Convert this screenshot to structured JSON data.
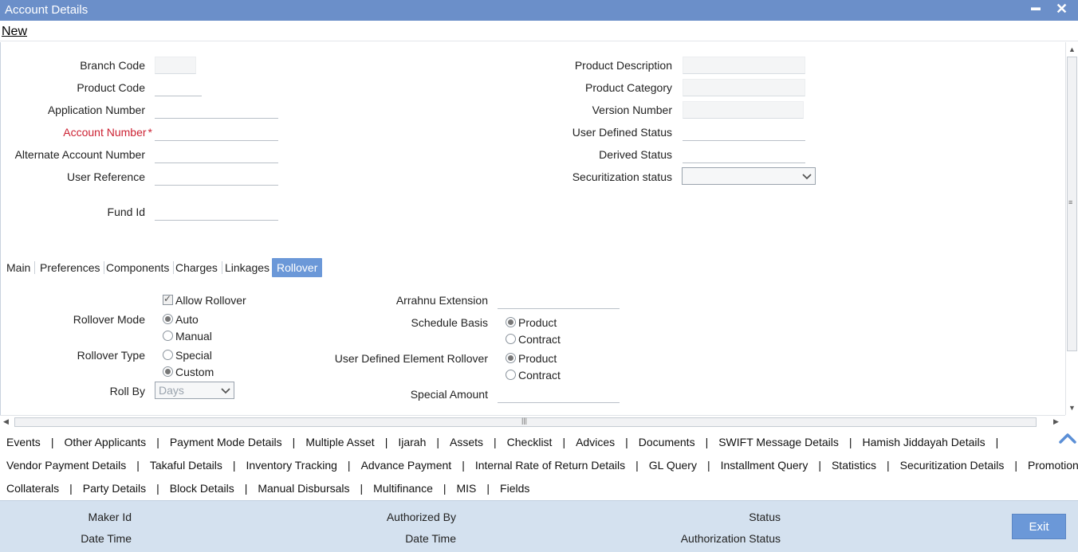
{
  "window": {
    "title": "Account Details",
    "minimize_glyph": "▬",
    "close_glyph": "✕"
  },
  "menu": {
    "new_label": "New"
  },
  "header_fields": {
    "branch_code": {
      "label": "Branch Code",
      "value": ""
    },
    "product_code": {
      "label": "Product Code",
      "value": ""
    },
    "application_number": {
      "label": "Application Number",
      "value": ""
    },
    "account_number": {
      "label": "Account Number",
      "value": "",
      "required_mark": "*"
    },
    "alternate_account_number": {
      "label": "Alternate Account Number",
      "value": ""
    },
    "user_reference": {
      "label": "User Reference",
      "value": ""
    },
    "fund_id": {
      "label": "Fund Id",
      "value": ""
    },
    "product_description": {
      "label": "Product Description",
      "value": ""
    },
    "product_category": {
      "label": "Product Category",
      "value": ""
    },
    "version_number": {
      "label": "Version Number",
      "value": ""
    },
    "user_defined_status": {
      "label": "User Defined Status",
      "value": ""
    },
    "derived_status": {
      "label": "Derived Status",
      "value": ""
    },
    "securitization_status": {
      "label": "Securitization status",
      "value": ""
    }
  },
  "tabs": [
    "Main",
    "Preferences",
    "Components",
    "Charges",
    "Linkages",
    "Rollover"
  ],
  "active_tab": "Rollover",
  "rollover": {
    "allow_rollover": {
      "label": "Allow Rollover",
      "checked": true
    },
    "rollover_mode": {
      "label": "Rollover Mode",
      "options": [
        "Auto",
        "Manual"
      ],
      "selected": "Auto"
    },
    "rollover_type": {
      "label": "Rollover Type",
      "options": [
        "Special",
        "Custom"
      ],
      "selected": "Custom"
    },
    "roll_by": {
      "label": "Roll By",
      "value": "Days"
    },
    "arrahnu_extension": {
      "label": "Arrahnu Extension",
      "value": ""
    },
    "schedule_basis": {
      "label": "Schedule Basis",
      "options": [
        "Product",
        "Contract"
      ],
      "selected": "Product"
    },
    "user_defined_element_rollover": {
      "label": "User Defined Element Rollover",
      "options": [
        "Product",
        "Contract"
      ],
      "selected": "Product"
    },
    "special_amount": {
      "label": "Special Amount",
      "value": ""
    }
  },
  "sub_links": {
    "row1": [
      "Events",
      "Other Applicants",
      "Payment Mode Details",
      "Multiple Asset",
      "Ijarah",
      "Assets",
      "Checklist",
      "Advices",
      "Documents",
      "SWIFT Message Details",
      "Hamish Jiddayah Details"
    ],
    "row2": [
      "Vendor Payment Details",
      "Takaful Details",
      "Inventory Tracking",
      "Advance Payment",
      "Internal Rate of Return Details",
      "GL Query",
      "Installment Query",
      "Statistics",
      "Securitization Details",
      "Promotions"
    ],
    "row3": [
      "Collaterals",
      "Party Details",
      "Block Details",
      "Manual Disbursals",
      "Multifinance",
      "MIS",
      "Fields"
    ],
    "separator": "|"
  },
  "footer": {
    "maker_id": "Maker Id",
    "maker_date_time": "Date Time",
    "authorized_by": "Authorized By",
    "auth_date_time": "Date Time",
    "status": "Status",
    "authorization_status": "Authorization Status",
    "exit_label": "Exit"
  },
  "colors": {
    "titlebar": "#6b8fc9",
    "accent": "#6b98d8",
    "footer": "#d4e1ef",
    "required": "#cc2233"
  }
}
